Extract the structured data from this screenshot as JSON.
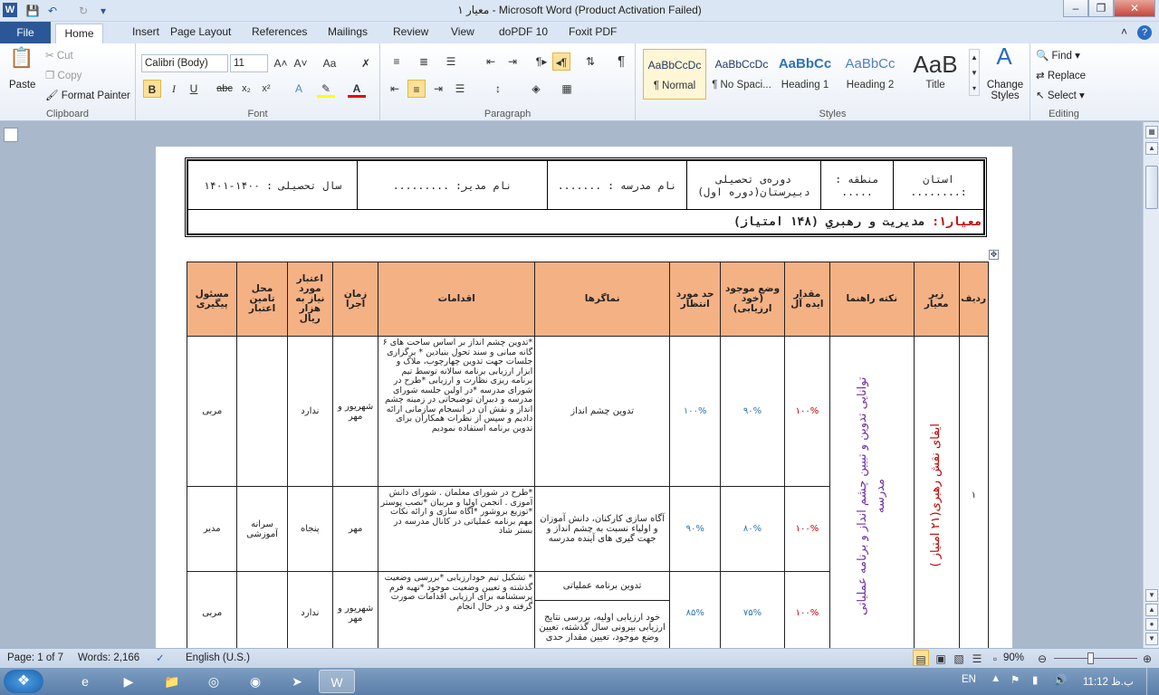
{
  "window": {
    "title": "معیار ۱ - Microsoft Word (Product Activation Failed)",
    "app_icon": "W"
  },
  "ribbon_tabs": [
    "File",
    "Home",
    "Insert",
    "Page Layout",
    "References",
    "Mailings",
    "Review",
    "View",
    "doPDF 10",
    "Foxit PDF"
  ],
  "clipboard": {
    "paste": "Paste",
    "cut": "Cut",
    "copy": "Copy",
    "format_painter": "Format Painter",
    "label": "Clipboard"
  },
  "font": {
    "name": "Calibri (Body)",
    "size": "11",
    "label": "Font"
  },
  "paragraph": {
    "label": "Paragraph"
  },
  "styles": {
    "label": "Styles",
    "items": [
      {
        "preview": "AaBbCcDc",
        "name": "¶ Normal"
      },
      {
        "preview": "AaBbCcDc",
        "name": "¶ No Spaci..."
      },
      {
        "preview": "AaBbCc",
        "name": "Heading 1"
      },
      {
        "preview": "AaBbCc",
        "name": "Heading 2"
      },
      {
        "preview": "AaB",
        "name": "Title"
      }
    ],
    "change": "Change Styles"
  },
  "editing": {
    "find": "Find",
    "replace": "Replace",
    "select": "Select",
    "label": "Editing"
  },
  "doc_header": {
    "province": "استان :........",
    "region": "منطقه : .....",
    "period": "دوره‌ی تحصیلی دبیرستان(دوره اول)",
    "school": "نام مدرسه : .......",
    "manager": "نام مدیر: .........",
    "year": "سال تحصیلی : ۱۴۰۰-۱۴۰۱",
    "criterion_label": "معیار۱:",
    "criterion_text": "مدیریت و رهبري (۱۴۸ امتیاز)"
  },
  "table_headers": [
    "ردیف",
    "زیر معیار",
    "نکته راهنما",
    "مقدار ایده آل",
    "وضع موجود (خود ارزیابی)",
    "حد مورد انتظار",
    "نماگرها",
    "اقدامات",
    "زمان اجرا",
    "اعتبار مورد نیاز به هزار ریال",
    "محل تامین اعتبار",
    "مسئول پیگیری"
  ],
  "row_number": "۱",
  "sub_criterion": "ایفای نقش رهبری(۲۱ امتیاز )",
  "guide_note": "توانایی تدوین و تبیین چشم انداز و برنامه عملیاتی مدرسه",
  "rows": [
    {
      "ideal": "۱۰۰%",
      "current": "۹۰%",
      "expected": "۱۰۰%",
      "indicator": "تدوین چشم انداز",
      "actions": "*تدوین چشم انداز بر اساس ساحت های ۶ گانه مبانی و سند تحول بنیادین * برگزاری جلسات جهت تدوین چهارچوب، ملاک و ابزار ارزیابی برنامه سالانه توسط تیم برنامه ریزی نظارت و ارزیابی *طرح در شورای مدرسه *در اولین جلسه شورای مدرسه و دبیران توضیحاتی در زمینه چشم انداز و نقش آن در انسجام سازمانی ارائه دادیم و سپس از نظرات همکاران برای تدوین برنامه استفاده نمودیم",
      "time": "شهریور و مهر",
      "credit": "ندارد",
      "source": "",
      "responsible": "مربی"
    },
    {
      "ideal": "۱۰۰%",
      "current": "۸۰%",
      "expected": "۹۰%",
      "indicator": "آگاه سازی کارکنان، دانش آموزان و اولیاء نسبت به چشم انداز و جهت گیری های آینده مدرسه",
      "actions": "*طرح در شورای معلمان . شورای دانش آموزی . انجمن اولیا و مربیان *نصب پوستر *توزیع بروشور *آگاه سازی و ارائه نکات مهم برنامه عملیاتی در کانال مدرسه در بستر شاد",
      "time": "مهر",
      "credit": "پنجاه",
      "source": "سرانه آموزشی",
      "responsible": "مدیر"
    },
    {
      "ideal": "۱۰۰%",
      "current": "۷۵%",
      "expected": "۸۵%",
      "indicator": "تدوین برنامه عملیاتی",
      "indicator2": "خود ارزیابی اولیه، بررسی نتایج ارزیابی بیرونی سال گذشته، تعیین وضع موجود، تعیین مقدار حدی",
      "actions": "* تشکیل تیم خودارزیابی *بررسی وضعیت گذشته و تعیین وضعیت موجود *تهیه فرم پرسشنامه برای ارزیابی اقدامات صورت گرفته و در حال انجام",
      "time": "شهریور و مهر",
      "credit": "ندارد",
      "source": "",
      "responsible": "مربی"
    }
  ],
  "status": {
    "page": "Page: 1 of 7",
    "words": "Words: 2,166",
    "language": "English (U.S.)",
    "zoom": "90%"
  },
  "taskbar": {
    "lang": "EN",
    "time": "11:12 ب.ظ"
  }
}
